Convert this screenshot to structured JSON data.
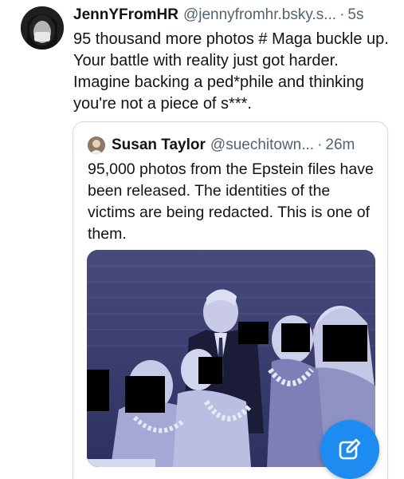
{
  "post": {
    "display_name": "JennYFromHR",
    "handle": "@jennyfromhr.bsky.s...",
    "separator": "·",
    "time": "5s",
    "text": "95 thousand more photos # Maga buckle up. Your battle with reality just got harder. Imagine backing a ped*phile and thinking you're not a piece of s***."
  },
  "quote": {
    "display_name": "Susan Taylor",
    "handle": "@suechitown...",
    "separator": "·",
    "time": "26m",
    "text": "95,000 photos from the Epstein files have been released. The identities of the victims are being redacted. This is one of them.",
    "image": {
      "caption_text": ""
    }
  },
  "icons": {
    "avatar": "profile-avatar",
    "quote_avatar": "profile-avatar",
    "compose": "compose-pencil-icon"
  },
  "colors": {
    "accent": "#1d8cf0",
    "muted_text": "#536471",
    "border": "#cfd9de"
  }
}
